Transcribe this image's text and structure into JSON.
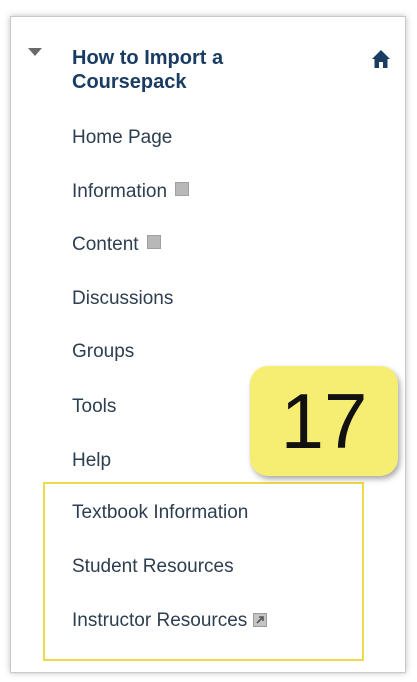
{
  "course": {
    "title_line1": "How to Import a",
    "title_line2": "Coursepack"
  },
  "menu": {
    "items": [
      {
        "label": "Home Page"
      },
      {
        "label": "Information"
      },
      {
        "label": "Content"
      },
      {
        "label": "Discussions"
      },
      {
        "label": "Groups"
      },
      {
        "label": "Tools"
      },
      {
        "label": "Help"
      },
      {
        "label": "Textbook Information"
      },
      {
        "label": "Student Resources"
      },
      {
        "label": "Instructor Resources"
      }
    ]
  },
  "callout": {
    "number": "17"
  },
  "icons": {
    "collapse": "triangle-down-icon",
    "home": "home-icon",
    "item_placeholder": "square-icon",
    "external": "external-link-icon"
  },
  "colors": {
    "title": "#1a3c63",
    "text": "#2d3e50",
    "highlight_border": "#f0d94a",
    "badge_fill": "#f6ee72"
  }
}
